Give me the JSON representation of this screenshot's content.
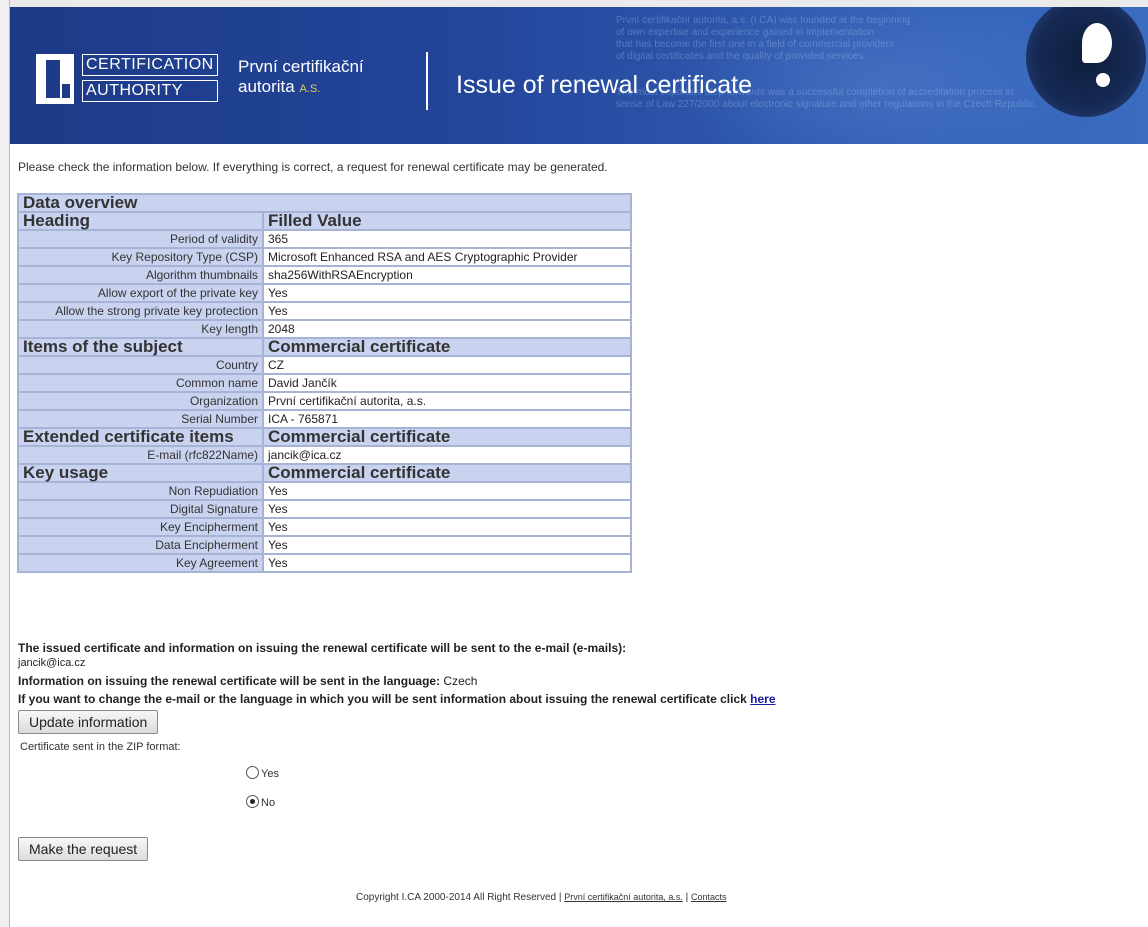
{
  "header": {
    "logo_line1": "CERTIFICATION",
    "logo_line2": "AUTHORITY",
    "brand_line1": "První certifikační",
    "brand_line2": "autorita",
    "brand_suffix": "A.S.",
    "title": "Issue of renewal certificate",
    "background_text": [
      "První certifikační autorita, a.s. (I.CA) was founded at the beginning",
      "of own expertise and experience gained in implementation",
      "that has become the first one in a field of commercial providers",
      "of digital certificates and the quality of provided services.",
      "The most important step forwards was a successful completion of accreditation process in",
      "sense of Law 227/2000 about electronic signature and other regulations in the Czech Republic."
    ]
  },
  "intro_text": "Please check the information below. If everything is correct, a request for renewal certificate may be generated.",
  "overview": {
    "title": "Data overview",
    "col_heading": "Heading",
    "col_value": "Filled Value",
    "general_rows": [
      {
        "label": "Period of validity",
        "value": "365"
      },
      {
        "label": "Key Repository Type (CSP)",
        "value": "Microsoft Enhanced RSA and AES Cryptographic Provider"
      },
      {
        "label": "Algorithm thumbnails",
        "value": "sha256WithRSAEncryption"
      },
      {
        "label": "Allow export of the private key",
        "value": "Yes"
      },
      {
        "label": "Allow the strong private key protection",
        "value": "Yes"
      },
      {
        "label": "Key length",
        "value": "2048"
      }
    ],
    "subject_heading": "Items of the subject",
    "subject_value_heading": "Commercial certificate",
    "subject_rows": [
      {
        "label": "Country",
        "value": "CZ"
      },
      {
        "label": "Common name",
        "value": "David Jančík"
      },
      {
        "label": "Organization",
        "value": "První certifikační autorita, a.s."
      },
      {
        "label": "Serial Number",
        "value": "ICA - 765871"
      }
    ],
    "extended_heading": "Extended certificate items",
    "extended_value_heading": "Commercial certificate",
    "extended_rows": [
      {
        "label": "E-mail (rfc822Name)",
        "value": "jancik@ica.cz"
      }
    ],
    "usage_heading": "Key usage",
    "usage_value_heading": "Commercial certificate",
    "usage_rows": [
      {
        "label": "Non Repudiation",
        "value": "Yes"
      },
      {
        "label": "Digital Signature",
        "value": "Yes"
      },
      {
        "label": "Key Encipherment",
        "value": "Yes"
      },
      {
        "label": "Data Encipherment",
        "value": "Yes"
      },
      {
        "label": "Key Agreement",
        "value": "Yes"
      }
    ]
  },
  "notice": {
    "sent_to_label": "The issued certificate and information on issuing the renewal certificate will be sent to the e-mail (e-mails):",
    "email": "jancik@ica.cz",
    "language_label": "Information on issuing the renewal certificate will be sent in the language:",
    "language": "Czech",
    "change_text": "If you want to change the e-mail or the language in which you will be sent information about issuing the renewal certificate click",
    "change_link": "here"
  },
  "buttons": {
    "update": "Update information",
    "make_request": "Make the request"
  },
  "zip": {
    "label": "Certificate sent in the ZIP format:",
    "options": [
      {
        "label": "Yes",
        "selected": false
      },
      {
        "label": "No",
        "selected": true
      }
    ]
  },
  "footer": {
    "copyright": "Copyright I.CA 2000-2014 All Right Reserved |",
    "company_link": "První certifikační autorita, a.s.",
    "separator": "|",
    "contacts_link": "Contacts"
  }
}
